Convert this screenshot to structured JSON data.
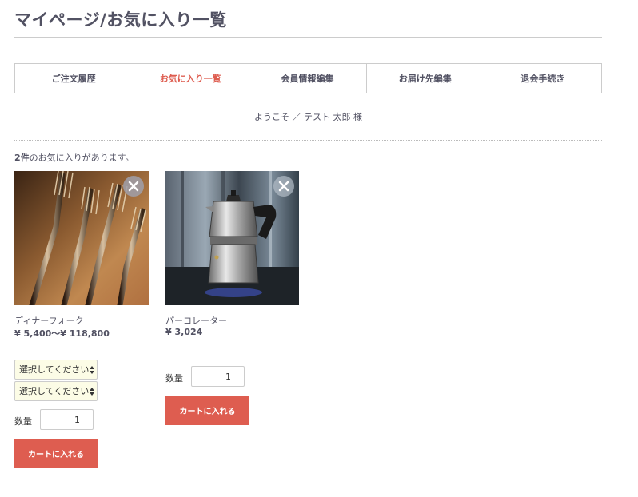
{
  "page": {
    "title": "マイページ/お気に入り一覧"
  },
  "tabs": [
    {
      "label": "ご注文履歴",
      "active": false
    },
    {
      "label": "お気に入り一覧",
      "active": true
    },
    {
      "label": "会員情報編集",
      "active": false
    },
    {
      "label": "お届け先編集",
      "active": false
    },
    {
      "label": "退会手続き",
      "active": false
    }
  ],
  "welcome": "ようこそ ／ テスト 太郎 様",
  "favorites": {
    "count": "2件",
    "count_suffix": "のお気に入りがあります。"
  },
  "products": [
    {
      "name": "ディナーフォーク",
      "price": "¥ 5,400〜¥ 118,800",
      "image_icon": "dinner-fork-photo",
      "selects": [
        "選択してください",
        "選択してください"
      ],
      "quantity_label": "数量",
      "quantity": "1",
      "cart_label": "カートに入れる"
    },
    {
      "name": "パーコレーター",
      "price": "¥ 3,024",
      "image_icon": "percolator-photo",
      "quantity_label": "数量",
      "quantity": "1",
      "cart_label": "カートに入れる"
    }
  ],
  "colors": {
    "accent": "#de5d50",
    "text": "#525263",
    "select_bg": "#fcfce6"
  }
}
